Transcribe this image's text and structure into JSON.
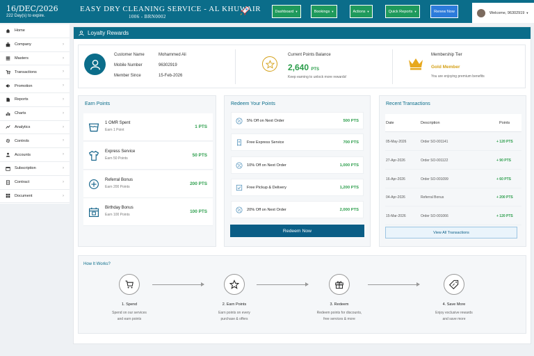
{
  "topbar": {
    "date": "16/DEC/2026",
    "expiry": "222 Day(s) to expire.",
    "title": "Easy Dry Cleaning Service - Al Khuwair",
    "branch": "1006 - BRN0002",
    "buttons": [
      "Dashboard",
      "Bookings",
      "Actions",
      "Quick Reports"
    ],
    "renew": "Renew Now",
    "welcome": "Welcome, 96302919",
    "accent": "#0b6d8a",
    "button_color": "#1f9a5c",
    "renew_color": "#2c7bdb"
  },
  "sidebar": {
    "items": [
      {
        "label": "Home",
        "icon": "home-icon",
        "chevron": false
      },
      {
        "label": "Company",
        "icon": "briefcase-icon",
        "chevron": true
      },
      {
        "label": "Masters",
        "icon": "layers-icon",
        "chevron": true
      },
      {
        "label": "Transactions",
        "icon": "cart-icon",
        "chevron": true
      },
      {
        "label": "Promotion",
        "icon": "megaphone-icon",
        "chevron": true
      },
      {
        "label": "Reports",
        "icon": "file-icon",
        "chevron": true
      },
      {
        "label": "Charts",
        "icon": "chart-icon",
        "chevron": true
      },
      {
        "label": "Analytics",
        "icon": "analytics-icon",
        "chevron": true
      },
      {
        "label": "Controls",
        "icon": "gear-icon",
        "chevron": true
      },
      {
        "label": "Accounts",
        "icon": "user-icon",
        "chevron": true
      },
      {
        "label": "Subscription",
        "icon": "calendar-icon",
        "chevron": true
      },
      {
        "label": "Contract",
        "icon": "document-icon",
        "chevron": true
      },
      {
        "label": "Document",
        "icon": "grid-icon",
        "chevron": true
      }
    ]
  },
  "page": {
    "title": "Loyalty Rewards"
  },
  "customer": {
    "name_label": "Customer Name",
    "name": "Mohammed Ali",
    "mobile_label": "Mobile Number",
    "mobile": "96302919",
    "since_label": "Member Since",
    "since": "15-Feb-2026"
  },
  "points": {
    "label": "Current Points Balance",
    "value": "2,640",
    "unit": "PTS",
    "note": "Keep earning to unlock more rewards!"
  },
  "tier": {
    "label": "Membership Tier",
    "value": "Gold Member",
    "note": "You are enjoying premium benefits"
  },
  "earn": {
    "title": "Earn Points",
    "items": [
      {
        "icon": "wash-icon",
        "title": "1 OMR Spent",
        "sub": "Earn 1 Point",
        "pts": "1 PTS"
      },
      {
        "icon": "shirt-icon",
        "title": "Express Service",
        "sub": "Earn 50 Points",
        "pts": "50 PTS"
      },
      {
        "icon": "plus-circle-icon",
        "title": "Referral Bonus",
        "sub": "Earn 200 Points",
        "pts": "200 PTS"
      },
      {
        "icon": "calendar-icon",
        "title": "Birthday Bonus",
        "sub": "Earn 100 Points",
        "pts": "100 PTS"
      }
    ]
  },
  "redeem": {
    "title": "Redeem Your Points",
    "items": [
      {
        "icon": "percent-icon",
        "title": "5% Off on Next Order",
        "pts": "500 PTS"
      },
      {
        "icon": "receipt-icon",
        "title": "Free Express Service",
        "pts": "700 PTS"
      },
      {
        "icon": "percent-icon",
        "title": "10% Off on Next Order",
        "pts": "1,000 PTS"
      },
      {
        "icon": "check-icon",
        "title": "Free Pickup & Delivery",
        "pts": "1,200 PTS"
      },
      {
        "icon": "percent-icon",
        "title": "20% Off on Next Order",
        "pts": "2,000 PTS"
      }
    ],
    "button": "Redeem Now"
  },
  "transactions": {
    "title": "Recent Transactions",
    "headers": [
      "Date",
      "Description",
      "Points"
    ],
    "rows": [
      {
        "date": "05-May-2026",
        "desc": "Order SO-001141",
        "pts": "+ 120 PTS"
      },
      {
        "date": "27-Apr-2026",
        "desc": "Order SO-001122",
        "pts": "+ 90 PTS"
      },
      {
        "date": "16-Apr-2026",
        "desc": "Order SO-001099",
        "pts": "+ 60 PTS"
      },
      {
        "date": "04-Apr-2026",
        "desc": "Referral Bonus",
        "pts": "+ 200 PTS"
      },
      {
        "date": "15-Mar-2026",
        "desc": "Order SO-001066",
        "pts": "+ 120 PTS"
      }
    ],
    "button": "View All Transactions"
  },
  "how": {
    "title": "How It Works?",
    "steps": [
      {
        "icon": "cart-icon",
        "title": "1. Spend",
        "d1": "Spend on our services",
        "d2": "and earn points"
      },
      {
        "icon": "star-icon",
        "title": "2. Earn Points",
        "d1": "Earn points on every",
        "d2": "purchase & offers"
      },
      {
        "icon": "gift-icon",
        "title": "3. Redeem",
        "d1": "Redeem points for discounts,",
        "d2": "free services & more"
      },
      {
        "icon": "tag-icon",
        "title": "4. Save More",
        "d1": "Enjoy exclusive rewards",
        "d2": "and save more"
      }
    ]
  }
}
